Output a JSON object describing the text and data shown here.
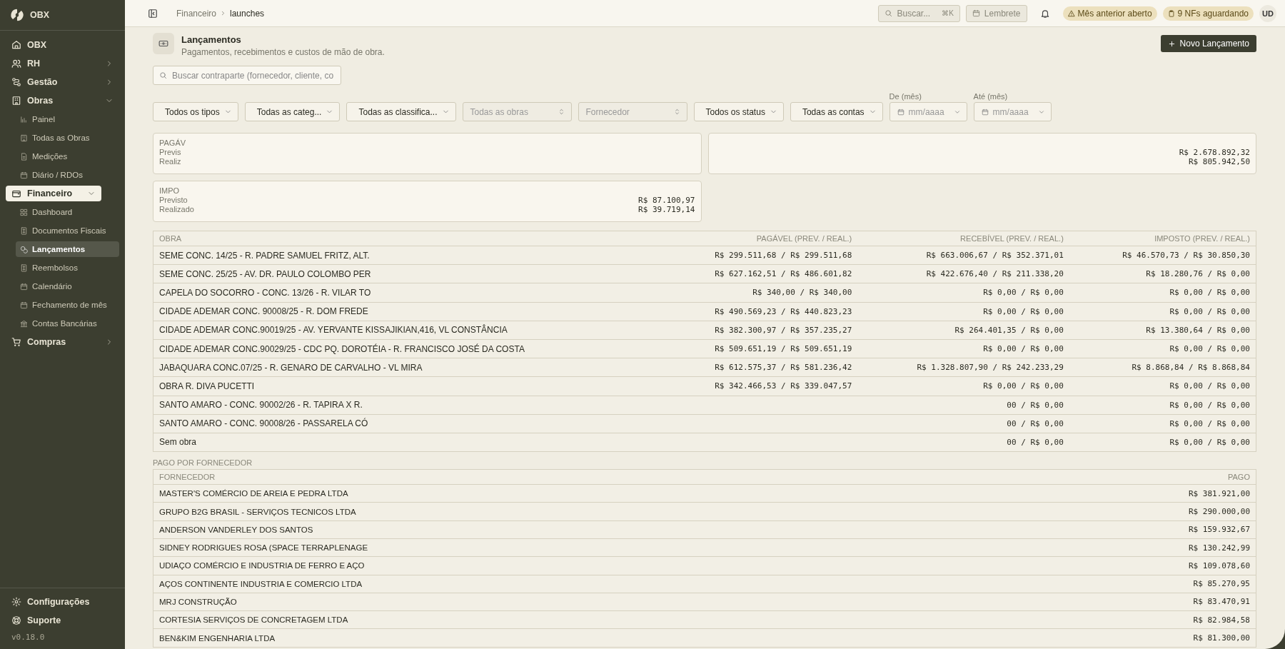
{
  "sidebar": {
    "brand": "OBX",
    "items": [
      {
        "label": "OBX",
        "selected": false
      },
      {
        "label": "RH",
        "selected": false,
        "expanded": false
      },
      {
        "label": "Gestão",
        "selected": false,
        "expanded": false
      },
      {
        "label": "Obras",
        "selected": false,
        "expanded": true,
        "children": [
          {
            "label": "Painel",
            "selected": false
          },
          {
            "label": "Todas as Obras",
            "selected": false
          },
          {
            "label": "Medições",
            "selected": false
          },
          {
            "label": "Diário / RDOs",
            "selected": false
          }
        ]
      },
      {
        "label": "Financeiro",
        "selected": true,
        "expanded": true,
        "children": [
          {
            "label": "Dashboard",
            "selected": false
          },
          {
            "label": "Documentos Fiscais",
            "selected": false
          },
          {
            "label": "Lançamentos",
            "selected": true
          },
          {
            "label": "Reembolsos",
            "selected": false
          },
          {
            "label": "Calendário",
            "selected": false
          },
          {
            "label": "Fechamento de mês",
            "selected": false
          },
          {
            "label": "Contas Bancárias",
            "selected": false
          }
        ]
      },
      {
        "label": "Compras",
        "selected": false,
        "expanded": false
      }
    ],
    "footer": [
      {
        "label": "Configurações"
      },
      {
        "label": "Suporte"
      }
    ],
    "version": "v0.18.0"
  },
  "topbar": {
    "breadcrumb": [
      "Financeiro",
      "launches"
    ],
    "search": {
      "placeholder": "Buscar...",
      "shortcut": "⌘K"
    },
    "reminder": "Lembrete",
    "badges": [
      "Mês anterior aberto",
      "9 NFs aguardando"
    ],
    "avatar": "UD"
  },
  "header": {
    "title": "Lançamentos",
    "subtitle": "Pagamentos, recebimentos e custos de mão de obra.",
    "button": "Novo Lançamento"
  },
  "search": {
    "placeholder": "Buscar contraparte (fornecedor, cliente, co"
  },
  "filters": [
    {
      "kind": "select",
      "value": "Todos os tipos"
    },
    {
      "kind": "select",
      "value": "Todas as categ..."
    },
    {
      "kind": "select",
      "value": "Todas as classifica..."
    },
    {
      "kind": "combobox",
      "placeholder": "Todas as obras"
    },
    {
      "kind": "combobox",
      "placeholder": "Fornecedor"
    },
    {
      "kind": "select",
      "value": "Todos os status"
    },
    {
      "kind": "select",
      "value": "Todas as contas"
    },
    {
      "kind": "month",
      "label": "De (mês)",
      "placeholder": "mm/aaaa"
    },
    {
      "kind": "month",
      "label": "Até (mês)",
      "placeholder": "mm/aaaa"
    }
  ],
  "summary": [
    {
      "title": "PAGÁV",
      "rows": [
        {
          "label": "Previs"
        },
        {
          "label": "Realiz"
        }
      ]
    },
    {
      "rows": [
        {
          "value": "R$ 2.678.892,32"
        },
        {
          "value": "R$ 805.942,50"
        }
      ]
    },
    {
      "title": "IMPO",
      "rows": [
        {
          "label": "Previsto",
          "value": "R$ 87.100,97"
        },
        {
          "label": "Realizado",
          "value": "R$ 39.719,14"
        }
      ]
    }
  ],
  "obras_table": {
    "columns": [
      "OBRA",
      "PAGÁVEL (PREV. / REAL.)",
      "RECEBÍVEL (PREV. / REAL.)",
      "IMPOSTO (PREV. / REAL.)"
    ],
    "rows": [
      {
        "obra": "SEME CONC. 14/25 - R. PADRE SAMUEL FRITZ, ALT.",
        "pagavel": "R$ 299.511,68 / R$ 299.511,68",
        "recebivel": "R$ 663.006,67 / R$ 352.371,01",
        "imposto": "R$ 46.570,73 / R$ 30.850,30"
      },
      {
        "obra": "SEME CONC. 25/25 - AV. DR. PAULO COLOMBO PER",
        "pagavel": "R$ 627.162,51 / R$ 486.601,82",
        "recebivel": "R$ 422.676,40 / R$ 211.338,20",
        "imposto": "R$ 18.280,76 / R$ 0,00"
      },
      {
        "obra": "CAPELA DO SOCORRO - CONC. 13/26 - R. VILAR TO",
        "pagavel": "R$ 340,00 / R$ 340,00",
        "recebivel": "R$ 0,00 / R$ 0,00",
        "imposto": "R$ 0,00 / R$ 0,00"
      },
      {
        "obra": "CIDADE ADEMAR CONC. 90008/25 - R. DOM FREDE",
        "pagavel": "R$ 490.569,23 / R$ 440.823,23",
        "recebivel": "R$ 0,00 / R$ 0,00",
        "imposto": "R$ 0,00 / R$ 0,00"
      },
      {
        "obra": "CIDADE ADEMAR CONC.90019/25 - AV. YERVANTE KISSAJIKIAN,416, VL CONSTÂNCIA",
        "pagavel": "R$ 382.300,97 / R$ 357.235,27",
        "recebivel": "R$ 264.401,35 / R$ 0,00",
        "imposto": "R$ 13.380,64 / R$ 0,00"
      },
      {
        "obra": "CIDADE ADEMAR CONC.90029/25 - CDC PQ. DOROTÉIA - R. FRANCISCO JOSÉ DA COSTA",
        "pagavel": "R$ 509.651,19 / R$ 509.651,19",
        "recebivel": "R$ 0,00 / R$ 0,00",
        "imposto": "R$ 0,00 / R$ 0,00"
      },
      {
        "obra": "JABAQUARA CONC.07/25 - R. GENARO DE CARVALHO - VL MIRA",
        "pagavel": "R$ 612.575,37 / R$ 581.236,42",
        "recebivel": "R$ 1.328.807,90 / R$ 242.233,29",
        "imposto": "R$ 8.868,84 / R$ 8.868,84"
      },
      {
        "obra": "OBRA R. DIVA PUCETTI",
        "pagavel": "R$ 342.466,53 / R$ 339.047,57",
        "recebivel": "R$ 0,00 / R$ 0,00",
        "imposto": "R$ 0,00 / R$ 0,00"
      },
      {
        "obra": "SANTO AMARO - CONC. 90002/26 - R. TAPIRA X R.",
        "recebivel": "00 / R$ 0,00",
        "imposto": "R$ 0,00 / R$ 0,00"
      },
      {
        "obra": "SANTO AMARO - CONC. 90008/26 - PASSARELA CÓ",
        "recebivel": "00 / R$ 0,00",
        "imposto": "R$ 0,00 / R$ 0,00"
      },
      {
        "obra": "Sem obra",
        "recebivel": "00 / R$ 0,00",
        "imposto": "R$ 0,00 / R$ 0,00"
      }
    ]
  },
  "suppliers": {
    "title": "PAGO POR FORNECEDOR",
    "columns": [
      "FORNECEDOR",
      "PAGO"
    ],
    "rows": [
      {
        "name": "MASTER'S COMÉRCIO DE AREIA E PEDRA LTDA",
        "paid": "R$ 381.921,00"
      },
      {
        "name": "GRUPO B2G BRASIL - SERVIÇOS TECNICOS LTDA",
        "paid": "R$ 290.000,00"
      },
      {
        "name": "ANDERSON VANDERLEY DOS SANTOS",
        "paid": "R$ 159.932,67"
      },
      {
        "name": "SIDNEY RODRIGUES ROSA (SPACE TERRAPLENAGE",
        "paid": "R$ 130.242,99"
      },
      {
        "name": "UDIAÇO COMÉRCIO E INDUSTRIA DE FERRO E AÇO",
        "paid": "R$ 109.078,60"
      },
      {
        "name": "AÇOS CONTINENTE INDUSTRIA E COMERCIO LTDA",
        "paid": "R$ 85.270,95"
      },
      {
        "name": "MRJ CONSTRUÇÃO",
        "paid": "R$ 83.470,91"
      },
      {
        "name": "CORTESIA SERVIÇOS DE CONCRETAGEM LTDA",
        "paid": "R$ 82.984,58"
      },
      {
        "name": "BEN&KIM ENGENHARIA LTDA",
        "paid": "R$ 81.300,00"
      }
    ]
  }
}
